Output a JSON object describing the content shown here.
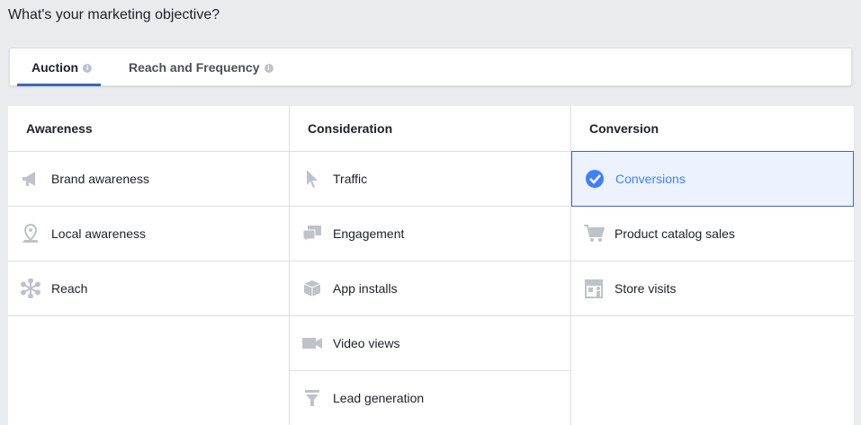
{
  "page": {
    "title": "What's your marketing objective?"
  },
  "tabs": [
    {
      "label": "Auction",
      "info": "i",
      "active": true
    },
    {
      "label": "Reach and Frequency",
      "info": "i",
      "active": false
    }
  ],
  "columns": [
    {
      "heading": "Awareness",
      "items": [
        {
          "label": "Brand awareness",
          "icon": "megaphone-icon"
        },
        {
          "label": "Local awareness",
          "icon": "map-pin-icon"
        },
        {
          "label": "Reach",
          "icon": "reach-asterisk-icon"
        }
      ]
    },
    {
      "heading": "Consideration",
      "items": [
        {
          "label": "Traffic",
          "icon": "cursor-icon"
        },
        {
          "label": "Engagement",
          "icon": "chat-bubbles-icon"
        },
        {
          "label": "App installs",
          "icon": "box-icon"
        },
        {
          "label": "Video views",
          "icon": "video-camera-icon"
        },
        {
          "label": "Lead generation",
          "icon": "funnel-icon"
        }
      ]
    },
    {
      "heading": "Conversion",
      "items": [
        {
          "label": "Conversions",
          "icon": "check-circle-icon",
          "selected": true
        },
        {
          "label": "Product catalog sales",
          "icon": "shopping-cart-icon"
        },
        {
          "label": "Store visits",
          "icon": "store-icon"
        }
      ]
    }
  ],
  "colors": {
    "accent": "#4267b2",
    "selected_bg": "#ecf3ff",
    "icon_gray": "#bec2c9",
    "selected_text": "#4080ff"
  }
}
